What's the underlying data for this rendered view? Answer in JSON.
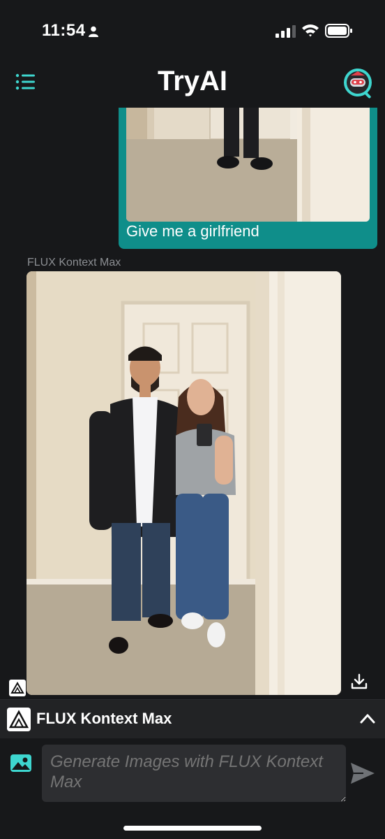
{
  "status_bar": {
    "time": "11:54",
    "icons": [
      "person-icon",
      "signal-icon",
      "wifi-icon",
      "battery-icon"
    ]
  },
  "header": {
    "title": "TryAI",
    "icons": [
      "menu-icon",
      "avatar"
    ]
  },
  "messages": [
    {
      "role": "user",
      "text": "Give me a girlfriend",
      "has_image": true
    },
    {
      "role": "assistant",
      "model_label": "FLUX Kontext Max",
      "has_image": true,
      "icons": [
        "flux-icon",
        "download-icon"
      ]
    }
  ],
  "model_selector": {
    "name": "FLUX Kontext Max",
    "icons": [
      "flux-logo-icon",
      "chevron-up-icon"
    ]
  },
  "composer": {
    "placeholder": "Generate Images with FLUX Kontext Max",
    "icons": [
      "image-picker-icon",
      "send-icon"
    ]
  },
  "colors": {
    "background": "#17181a",
    "accent": "#0f8e8a",
    "icon_teal": "#3ed6cf",
    "panel": "#222325",
    "input": "#2d2e31"
  }
}
